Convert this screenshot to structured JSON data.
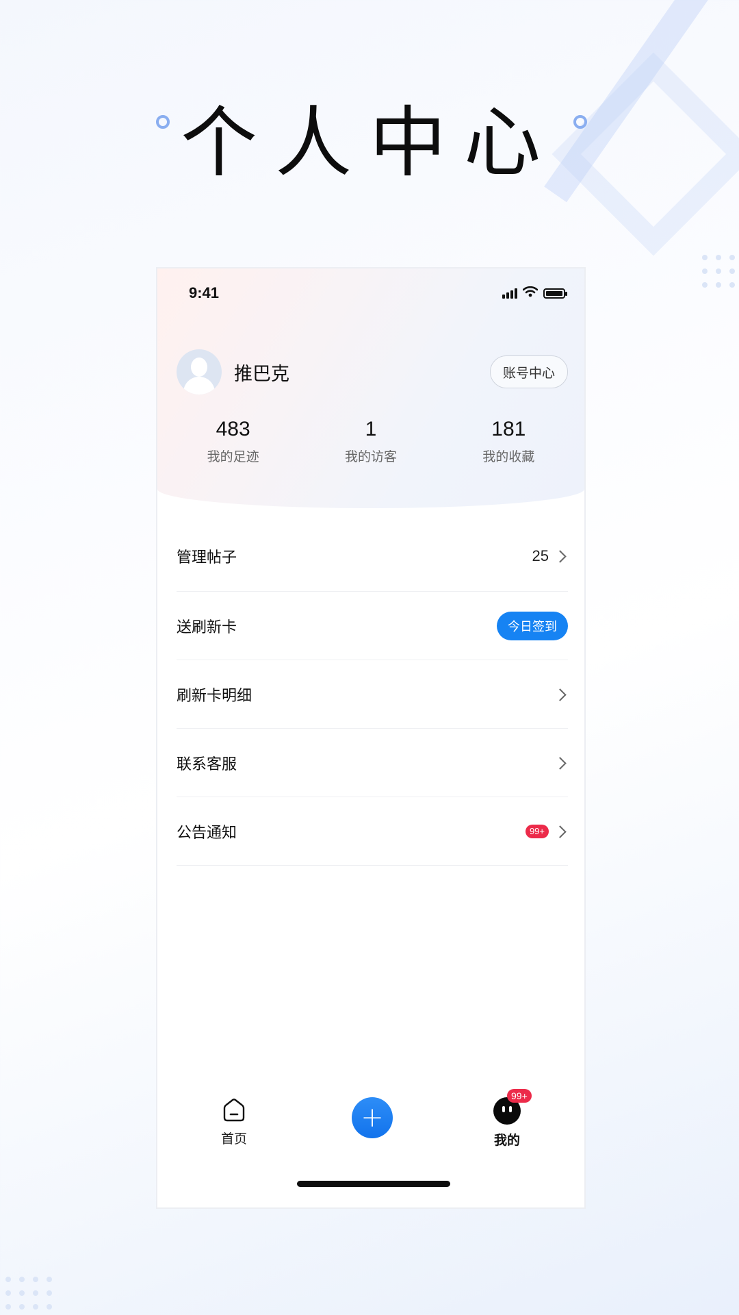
{
  "page": {
    "headline": "个人中心"
  },
  "status_bar": {
    "time": "9:41",
    "icons": [
      "signal-icon",
      "wifi-icon",
      "battery-icon"
    ]
  },
  "profile": {
    "username": "推巴克",
    "account_button": "账号中心"
  },
  "stats": [
    {
      "value": "483",
      "label": "我的足迹"
    },
    {
      "value": "1",
      "label": "我的访客"
    },
    {
      "value": "181",
      "label": "我的收藏"
    }
  ],
  "menu": [
    {
      "label": "管理帖子",
      "count": "25"
    },
    {
      "label": "送刷新卡",
      "button": "今日签到"
    },
    {
      "label": "刷新卡明细"
    },
    {
      "label": "联系客服"
    },
    {
      "label": "公告通知",
      "badge": "99+"
    }
  ],
  "tabbar": {
    "home": "首页",
    "add": "+",
    "mine": "我的",
    "mine_badge": "99+"
  },
  "colors": {
    "accent": "#1683f3",
    "badge": "#ec2b4a",
    "text": "#111111"
  }
}
